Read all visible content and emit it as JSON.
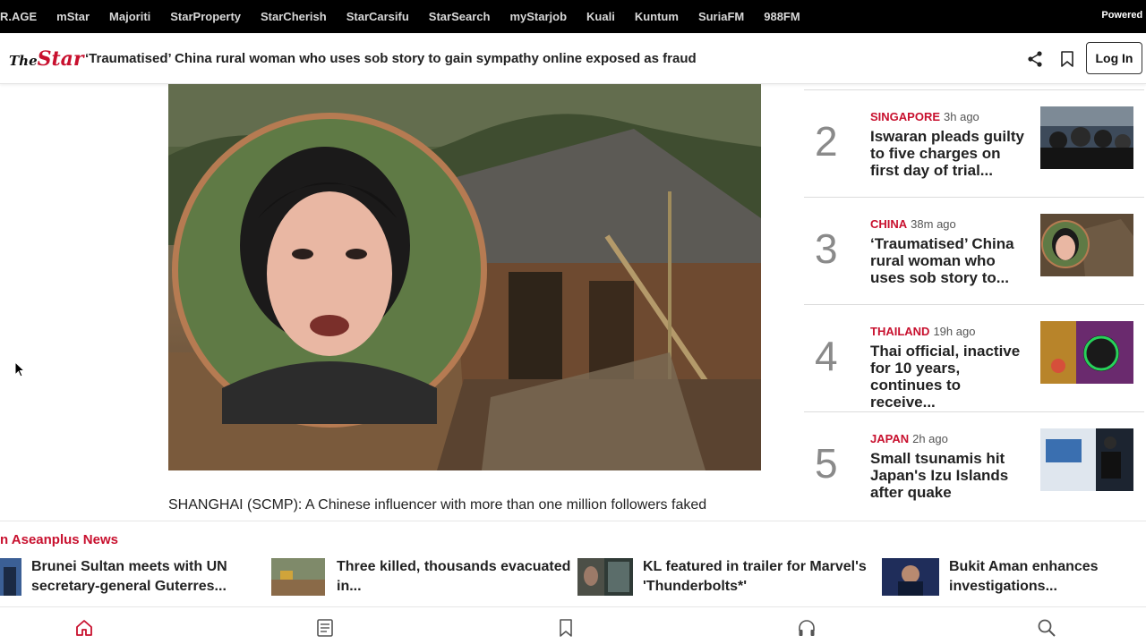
{
  "topbar": {
    "links": [
      "R.AGE",
      "mStar",
      "Majoriti",
      "StarProperty",
      "StarCherish",
      "StarCarsifu",
      "StarSearch",
      "myStarjob",
      "Kuali",
      "Kuntum",
      "SuriaFM",
      "988FM"
    ],
    "powered_text": "Powered b"
  },
  "header": {
    "logo_the": "The",
    "logo_star": "Star",
    "headline": "‘Traumatised’ China rural woman who uses sob story to gain sympathy online exposed as fraud",
    "login_label": "Log In",
    "share_icon": "share-icon",
    "bookmark_icon": "bookmark-icon"
  },
  "article": {
    "first_paragraph": "SHANGHAI (SCMP): A Chinese influencer with more than one million followers faked"
  },
  "trending": {
    "items": [
      {
        "rank": "2",
        "category": "SINGAPORE",
        "time": "3h ago",
        "title": "Iswaran pleads guilty to five charges on first day of trial..."
      },
      {
        "rank": "3",
        "category": "CHINA",
        "time": "38m ago",
        "title": "‘Traumatised’ China rural woman who uses sob story to..."
      },
      {
        "rank": "4",
        "category": "THAILAND",
        "time": "19h ago",
        "title": "Thai official, inactive for 10 years, continues to receive..."
      },
      {
        "rank": "5",
        "category": "JAPAN",
        "time": "2h ago",
        "title": "Small tsunamis hit Japan's Izu Islands after quake"
      }
    ]
  },
  "asean": {
    "title": "n Aseanplus News",
    "items": [
      {
        "line1": "Brunei Sultan meets with UN",
        "line2": "secretary-general Guterres..."
      },
      {
        "line1": "Three killed, thousands evacuated",
        "line2": "in..."
      },
      {
        "line1": "KL featured in trailer for Marvel's",
        "line2": "'Thunderbolts*'"
      },
      {
        "line1": "Bukit Aman enhances",
        "line2": "investigations..."
      }
    ]
  },
  "bottomnav": {
    "icons": [
      "home-icon",
      "news-icon",
      "bookmark-icon",
      "headphones-icon",
      "search-icon"
    ],
    "active_color": "#c8102e"
  },
  "colors": {
    "brand": "#c8102e",
    "topbar_bg": "#000000"
  }
}
